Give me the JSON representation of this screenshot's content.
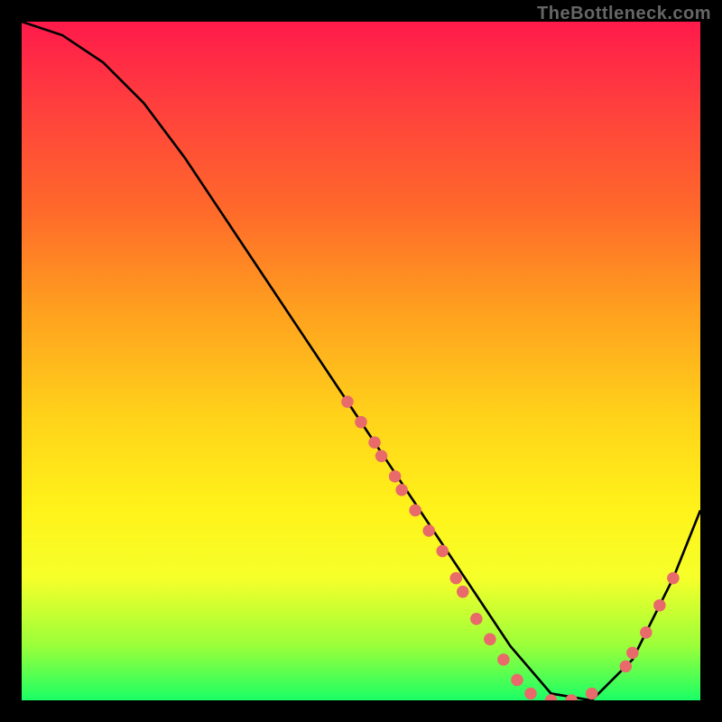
{
  "watermark": "TheBottleneck.com",
  "chart_data": {
    "type": "line",
    "title": "",
    "xlabel": "",
    "ylabel": "",
    "xlim": [
      0,
      100
    ],
    "ylim": [
      0,
      100
    ],
    "series": [
      {
        "name": "curve",
        "x": [
          0,
          6,
          12,
          18,
          24,
          30,
          36,
          42,
          48,
          54,
          60,
          66,
          72,
          78,
          84,
          90,
          96,
          100
        ],
        "y": [
          100,
          98,
          94,
          88,
          80,
          71,
          62,
          53,
          44,
          35,
          26,
          17,
          8,
          1,
          0,
          6,
          18,
          28
        ]
      }
    ],
    "markers": [
      {
        "x": 48,
        "y": 44
      },
      {
        "x": 50,
        "y": 41
      },
      {
        "x": 52,
        "y": 38
      },
      {
        "x": 53,
        "y": 36
      },
      {
        "x": 55,
        "y": 33
      },
      {
        "x": 56,
        "y": 31
      },
      {
        "x": 58,
        "y": 28
      },
      {
        "x": 60,
        "y": 25
      },
      {
        "x": 62,
        "y": 22
      },
      {
        "x": 64,
        "y": 18
      },
      {
        "x": 65,
        "y": 16
      },
      {
        "x": 67,
        "y": 12
      },
      {
        "x": 69,
        "y": 9
      },
      {
        "x": 71,
        "y": 6
      },
      {
        "x": 73,
        "y": 3
      },
      {
        "x": 75,
        "y": 1
      },
      {
        "x": 78,
        "y": 0
      },
      {
        "x": 81,
        "y": 0
      },
      {
        "x": 84,
        "y": 1
      },
      {
        "x": 89,
        "y": 5
      },
      {
        "x": 90,
        "y": 7
      },
      {
        "x": 92,
        "y": 10
      },
      {
        "x": 94,
        "y": 14
      },
      {
        "x": 96,
        "y": 18
      }
    ],
    "marker_color": "#e86a6a",
    "curve_color": "#000000"
  }
}
